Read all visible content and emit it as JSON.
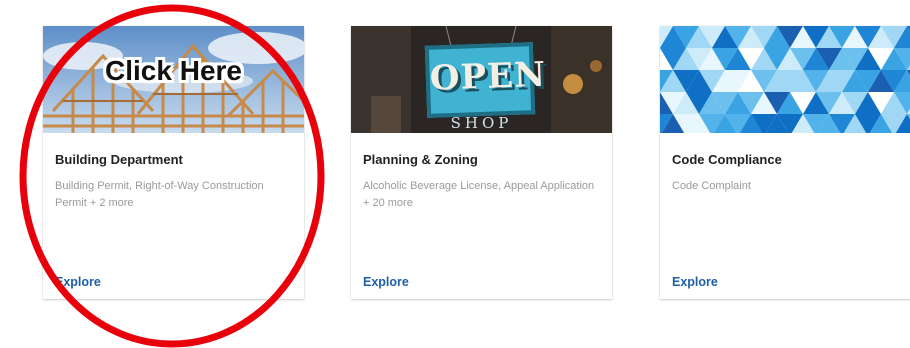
{
  "cards": [
    {
      "title": "Building Department",
      "description": "Building Permit, Right-of-Way Construction Permit + 2 more",
      "explore": "Explore",
      "image_overlay": "Click Here"
    },
    {
      "title": "Planning & Zoning",
      "description": "Alcoholic Beverage License, Appeal Application + 20 more",
      "explore": "Explore",
      "sign_text": "OPEN",
      "sign_subtext": "SHOP"
    },
    {
      "title": "Code Compliance",
      "description": "Code Complaint",
      "explore": "Explore"
    }
  ],
  "colors": {
    "link": "#1f5fa8",
    "annotation_circle": "#e8000b",
    "open_sign": "#3fb3d1"
  },
  "icons": {
    "card1_image": "house-framing-image",
    "card2_image": "open-sign-image",
    "card3_image": "blue-triangle-pattern-image"
  }
}
